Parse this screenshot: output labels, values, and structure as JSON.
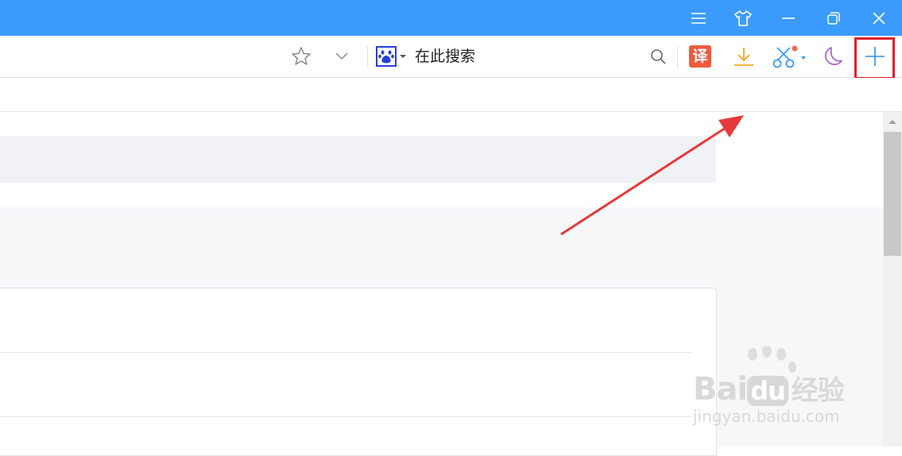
{
  "colors": {
    "titlebar": "#3b9bfc",
    "accent_red": "#e0202a",
    "translate": "#ef5a3c",
    "download": "#f5a623",
    "screenshot": "#3b9bfc",
    "night": "#a45fd0",
    "add": "#2f8ff0"
  },
  "titlebar": {
    "buttons": [
      {
        "name": "menu",
        "icon": "hamburger-icon"
      },
      {
        "name": "skin",
        "icon": "tshirt-icon"
      },
      {
        "name": "minimize",
        "icon": "minimize-icon"
      },
      {
        "name": "restore",
        "icon": "restore-icon"
      },
      {
        "name": "close",
        "icon": "close-icon"
      }
    ]
  },
  "toolbar": {
    "search_placeholder": "在此搜索",
    "translate_label": "译",
    "icons": [
      "star-icon",
      "chevron-down-icon",
      "baidu-paw-icon",
      "search-icon",
      "translate-icon",
      "download-icon",
      "scissors-icon",
      "moon-icon",
      "plus-icon"
    ]
  },
  "watermark": {
    "brand": "Bai",
    "brand_du": "du",
    "brand_cn": "经验",
    "url": "jingyan.baidu.com"
  }
}
